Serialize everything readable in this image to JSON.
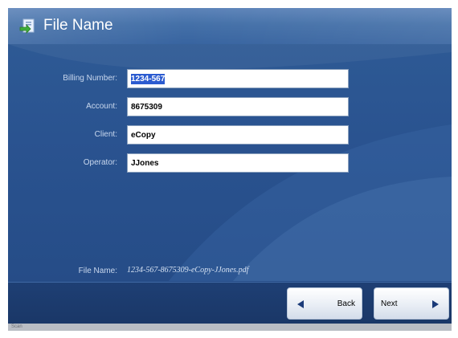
{
  "window": {
    "title": "File Name"
  },
  "fields": [
    {
      "label": "Billing Number:",
      "value": "1234-567",
      "selected": true
    },
    {
      "label": "Account:",
      "value": "8675309",
      "selected": false
    },
    {
      "label": "Client:",
      "value": "eCopy",
      "selected": false
    },
    {
      "label": "Operator:",
      "value": "JJones",
      "selected": false
    }
  ],
  "file_name": {
    "label": "File Name:",
    "value": "1234-567-8675309-eCopy-JJones.pdf"
  },
  "buttons": {
    "back": "Back",
    "next": "Next"
  },
  "status": {
    "text": "Scan"
  },
  "icons": {
    "title": "document-icon",
    "back": "arrow-left-icon",
    "next": "arrow-right-icon"
  },
  "colors": {
    "background": "#2a5390",
    "title_bar": "#4470a8",
    "bottom_bar": "#1e3f74",
    "selection": "#2b5bd0"
  }
}
